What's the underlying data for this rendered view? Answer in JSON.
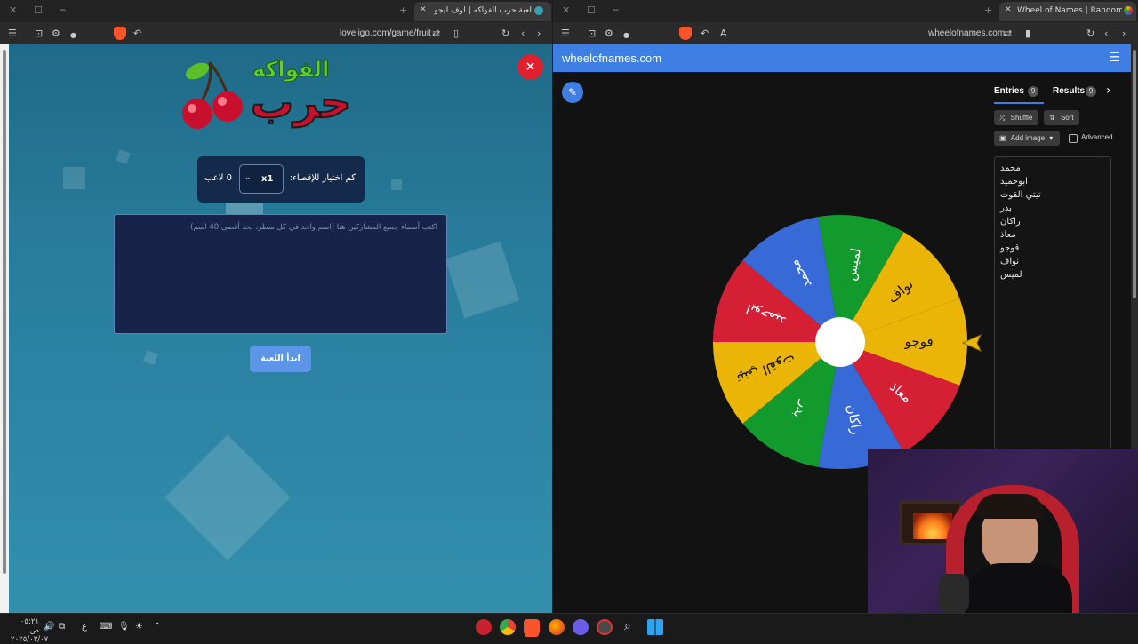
{
  "left_window": {
    "tab_title": "لعبة حرب الفواكه | لوف ليجو يوفر",
    "url": "loveligo.com/game/fruit",
    "game": {
      "logo_text_top": "الفواكه",
      "logo_text_main": "حرب",
      "count_label": "كم اختيار للإقصاء:",
      "count_value": "x1",
      "players_label": "0 لاعب",
      "names_placeholder": "اكتب أسماء جميع المشاركين هنا (اسم واحد في كل سطر، بحد أقصى 40 اسم)",
      "start_button": "ابدأ اللعبة",
      "close_symbol": "×"
    }
  },
  "right_window": {
    "tab_title": "Wheel of Names | Random nam",
    "url": "wheelofnames.com",
    "brand": "wheelofnames.com",
    "tabs": [
      {
        "label": "Entries",
        "count": "9"
      },
      {
        "label": "Results",
        "count": "9"
      }
    ],
    "buttons": {
      "shuffle": "Shuffle",
      "sort": "Sort",
      "add_image": "Add image",
      "advanced": "Advanced"
    },
    "entries": [
      "محمد",
      "ابوحميد",
      "تيتي القوت",
      "بدر",
      "راكان",
      "معاذ",
      "قوجو",
      "نواف",
      "لميس"
    ],
    "wheel": {
      "colors": [
        "#eab506",
        "#d51f34",
        "#3769d7",
        "#129a2c"
      ],
      "segments": [
        "قوجو",
        "معاذ",
        "راكان",
        "بدر",
        "تيتي القوت",
        "ابوحميد",
        "محمد",
        "لميس",
        "نواف"
      ]
    }
  },
  "taskbar": {
    "time": "٠٥:٢١ ص",
    "date": "٢٠٢٥/٠٣/٠٧",
    "lang": "ع"
  }
}
